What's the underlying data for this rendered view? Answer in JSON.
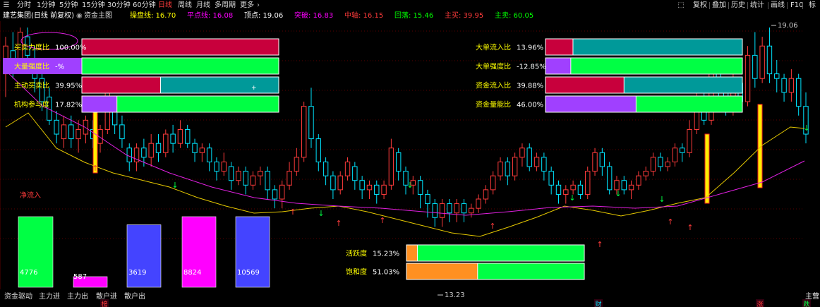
{
  "toolbar": {
    "timeframes": [
      "分时",
      "1分钟",
      "5分钟",
      "15分钟",
      "30分钟",
      "60分钟",
      "日线",
      "周线",
      "月线",
      "多周期",
      "更多"
    ],
    "active_index": 6,
    "right_buttons": [
      "复权",
      "叠加",
      "历史",
      "统计",
      "画线",
      "F10",
      "标"
    ]
  },
  "infobar": {
    "stock": "建艺集团(日线 前复权)",
    "indicator": "资金主图",
    "items": [
      {
        "label": "操盘线:",
        "value": "16.70",
        "color": "#ffff00"
      },
      {
        "label": "平点线:",
        "value": "16.08",
        "color": "#ff00ff"
      },
      {
        "label": "顶点:",
        "value": "19.06",
        "color": "#ffffff"
      },
      {
        "label": "突破:",
        "value": "16.83",
        "color": "#ff00ff"
      },
      {
        "label": "中轴:",
        "value": "16.15",
        "color": "#ff3b3b"
      },
      {
        "label": "回落:",
        "value": "15.46",
        "color": "#00ff00"
      },
      {
        "label": "主买:",
        "value": "39.95",
        "color": "#ff3b3b"
      },
      {
        "label": "主卖:",
        "value": "60.05",
        "color": "#00ff00"
      }
    ]
  },
  "indicators_left": [
    {
      "label": "买卖力度比",
      "value": "100.00%",
      "fill": 1.0,
      "fill_color": "#c8003c",
      "rest_color": "#c8003c"
    },
    {
      "label": "大量强度比",
      "value": "-%",
      "fill": 0.0,
      "fill_color": "#a040ff",
      "rest_color": "#00ff44"
    },
    {
      "label": "主动买卖比",
      "value": "39.95%",
      "fill": 0.3995,
      "fill_color": "#c8003c",
      "rest_color": "#009999"
    },
    {
      "label": "机构参与度",
      "value": "17.82%",
      "fill": 0.1782,
      "fill_color": "#a040ff",
      "rest_color": "#00ff44"
    }
  ],
  "indicators_right": [
    {
      "label": "大单流入比",
      "value": "13.96%",
      "fill": 0.1396,
      "fill_color": "#c8003c",
      "rest_color": "#009999"
    },
    {
      "label": "大单强度比",
      "value": "-12.85%",
      "fill": 0.1285,
      "fill_color": "#a040ff",
      "rest_color": "#00ff44"
    },
    {
      "label": "资金流入比",
      "value": "39.88%",
      "fill": 0.3988,
      "fill_color": "#c8003c",
      "rest_color": "#009999"
    },
    {
      "label": "资金量能比",
      "value": "46.00%",
      "fill": 0.46,
      "fill_color": "#a040ff",
      "rest_color": "#00ff44"
    }
  ],
  "indicators_mid": [
    {
      "label": "活跃度",
      "value": "15.23%",
      "fill": 0.0613,
      "fill_color": "#ff9020",
      "rest_color": "#00ff44"
    },
    {
      "label": "饱和度",
      "value": "51.03%",
      "fill": 0.4,
      "fill_color": "#ff9020",
      "rest_color": "#00ff44"
    }
  ],
  "volume_bars": [
    {
      "value": "4776",
      "color": "#00ff44",
      "level": 0.155
    },
    {
      "value": "587",
      "color": "#ff00ff",
      "level": 0.02
    },
    {
      "value": "3619",
      "color": "#4444ff",
      "level": 0.118
    },
    {
      "value": "8824",
      "color": "#ff00ff",
      "level": 0.288
    },
    {
      "value": "10569",
      "color": "#4444ff",
      "level": 0.345
    }
  ],
  "chart_text": {
    "high_label": "19.06",
    "low_label": "13.23",
    "inflow_label": "净流入",
    "bottom_markers": [
      "榜",
      "财",
      "涨",
      "跌"
    ],
    "right_edge_label": "主营"
  },
  "bottom_tabs": [
    "资金驱动",
    "主力进",
    "主力出",
    "散户进",
    "散户出"
  ]
}
